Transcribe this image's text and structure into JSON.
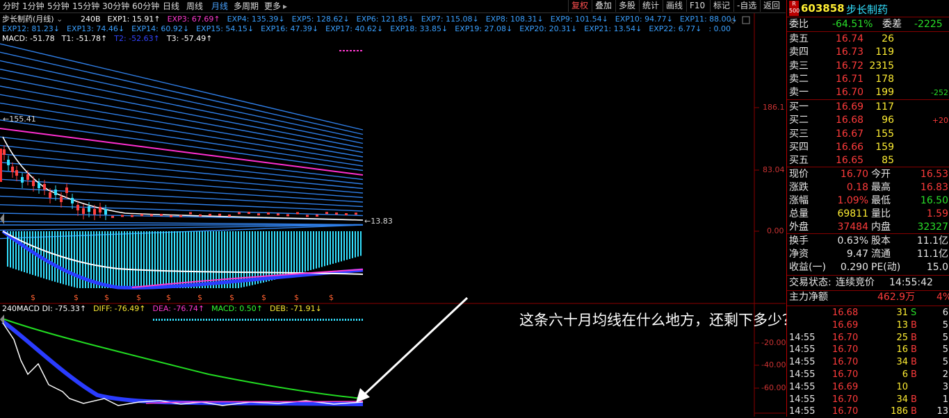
{
  "toolbar": {
    "tabs": [
      "分时",
      "1分钟",
      "5分钟",
      "15分钟",
      "30分钟",
      "60分钟",
      "日线",
      "周线",
      "月线",
      "多周期",
      "更多"
    ],
    "right_tabs": [
      "复权",
      "叠加",
      "多股",
      "统计",
      "画线",
      "F10",
      "标记",
      "-自选",
      "返回"
    ]
  },
  "chart": {
    "title": "步长制药(月线)",
    "exp_row1": [
      {
        "label": "240B",
        "color": "#ffffff"
      },
      {
        "label": "EXP1: 15.91↑",
        "color": "#ffffff"
      },
      {
        "label": "EXP3: 67.69↑",
        "color": "#ff3ad0"
      },
      {
        "label": "EXP4: 135.39↓",
        "color": "#3aa0ff"
      },
      {
        "label": "EXP5: 128.62↓",
        "color": "#3aa0ff"
      },
      {
        "label": "EXP6: 121.85↓",
        "color": "#3aa0ff"
      },
      {
        "label": "EXP7: 115.08↓",
        "color": "#3aa0ff"
      },
      {
        "label": "EXP8: 108.31↓",
        "color": "#3aa0ff"
      },
      {
        "label": "EXP9: 101.54↓",
        "color": "#3aa0ff"
      },
      {
        "label": "EXP10: 94.77↓",
        "color": "#3aa0ff"
      },
      {
        "label": "EXP11: 88.00↓",
        "color": "#3aa0ff"
      }
    ],
    "exp_row2": [
      {
        "label": "EXP12: 81.23↓",
        "color": "#3aa0ff"
      },
      {
        "label": "EXP13: 74.46↓",
        "color": "#3aa0ff"
      },
      {
        "label": "EXP14: 60.92↓",
        "color": "#3aa0ff"
      },
      {
        "label": "EXP15: 54.15↓",
        "color": "#3aa0ff"
      },
      {
        "label": "EXP16: 47.39↓",
        "color": "#3aa0ff"
      },
      {
        "label": "EXP17: 40.62↓",
        "color": "#3aa0ff"
      },
      {
        "label": "EXP18: 33.85↓",
        "color": "#3aa0ff"
      },
      {
        "label": "EXP19: 27.08↓",
        "color": "#3aa0ff"
      },
      {
        "label": "EXP20: 20.31↓",
        "color": "#3aa0ff"
      },
      {
        "label": "EXP21: 13.54↓",
        "color": "#3aa0ff"
      },
      {
        "label": "EXP22: 6.77↓",
        "color": "#3aa0ff"
      },
      {
        "label": ": 0.00",
        "color": "#3aa0ff"
      }
    ],
    "macd_row": [
      {
        "label": "MACD: -51.78",
        "color": "#ffffff"
      },
      {
        "label": "T1: -51.78↑",
        "color": "#ffffff"
      },
      {
        "label": "T2: -52.63↑",
        "color": "#3344ff"
      },
      {
        "label": "T3: -57.49↑",
        "color": "#ffffff"
      }
    ],
    "price_high": "155.41",
    "price_low": "13.83",
    "y_axis_main": [
      "186.1",
      "83.04",
      "0.00"
    ],
    "sub_title": [
      {
        "label": "240MACD DI: -75.33↑",
        "color": "#ffffff"
      },
      {
        "label": "DIFF: -76.49↑",
        "color": "#ffee33"
      },
      {
        "label": "DEA: -76.74↑",
        "color": "#ff3ad0"
      },
      {
        "label": "MACD: 0.50↑",
        "color": "#33ff33"
      },
      {
        "label": "DEB: -71.91↓",
        "color": "#ffee33"
      }
    ],
    "y_axis_sub": [
      "-20.00",
      "-40.00",
      "-60.00"
    ],
    "annotation": "这条六十月均线在什么地方，还剩下多少？"
  },
  "panel": {
    "code": "603858",
    "name": "步长制药",
    "badge_top": "R",
    "badge_bottom": "500",
    "weibi_label": "委比",
    "weibi_value": "-64.51%",
    "weicha_label": "委差",
    "weicha_value": "-2225",
    "sell": [
      {
        "label": "卖五",
        "price": "16.74",
        "vol": "26",
        "chg": ""
      },
      {
        "label": "卖四",
        "price": "16.73",
        "vol": "119",
        "chg": ""
      },
      {
        "label": "卖三",
        "price": "16.72",
        "vol": "2315",
        "chg": ""
      },
      {
        "label": "卖二",
        "price": "16.71",
        "vol": "178",
        "chg": ""
      },
      {
        "label": "卖一",
        "price": "16.70",
        "vol": "199",
        "chg": "-252"
      }
    ],
    "buy": [
      {
        "label": "买一",
        "price": "16.69",
        "vol": "117",
        "chg": ""
      },
      {
        "label": "买二",
        "price": "16.68",
        "vol": "96",
        "chg": "+20"
      },
      {
        "label": "买三",
        "price": "16.67",
        "vol": "155",
        "chg": ""
      },
      {
        "label": "买四",
        "price": "16.66",
        "vol": "159",
        "chg": ""
      },
      {
        "label": "买五",
        "price": "16.65",
        "vol": "85",
        "chg": ""
      }
    ],
    "stats": [
      {
        "l1": "现价",
        "v1": "16.70",
        "c1": "red",
        "l2": "今开",
        "v2": "16.53",
        "c2": "red"
      },
      {
        "l1": "涨跌",
        "v1": "0.18",
        "c1": "red",
        "l2": "最高",
        "v2": "16.83",
        "c2": "red"
      },
      {
        "l1": "涨幅",
        "v1": "1.09%",
        "c1": "red",
        "l2": "最低",
        "v2": "16.50",
        "c2": "green"
      },
      {
        "l1": "总量",
        "v1": "69811",
        "c1": "yellow",
        "l2": "量比",
        "v2": "1.59",
        "c2": "red"
      },
      {
        "l1": "外盘",
        "v1": "37484",
        "c1": "red",
        "l2": "内盘",
        "v2": "32327",
        "c2": "green"
      }
    ],
    "stats2": [
      {
        "l1": "换手",
        "v1": "0.63%",
        "l2": "股本",
        "v2": "11.1亿"
      },
      {
        "l1": "净资",
        "v1": "9.47",
        "l2": "流通",
        "v2": "11.1亿"
      },
      {
        "l1": "收益(一)",
        "v1": "0.290",
        "l2": "PE(动)",
        "v2": "15.0"
      }
    ],
    "trade_status_label": "交易状态:",
    "trade_status": "连续竞价",
    "trade_time": "14:55:42",
    "net_label": "主力净额",
    "net_value": "462.9万",
    "net_pct": "4%",
    "ticks": [
      {
        "time": "",
        "price": "16.68",
        "vol": "31",
        "bs": "S",
        "n": "6"
      },
      {
        "time": "",
        "price": "16.69",
        "vol": "13",
        "bs": "B",
        "n": "5"
      },
      {
        "time": "14:55",
        "price": "16.70",
        "vol": "25",
        "bs": "B",
        "n": "5"
      },
      {
        "time": "14:55",
        "price": "16.70",
        "vol": "16",
        "bs": "B",
        "n": "5"
      },
      {
        "time": "14:55",
        "price": "16.70",
        "vol": "34",
        "bs": "B",
        "n": "5"
      },
      {
        "time": "14:55",
        "price": "16.70",
        "vol": "6",
        "bs": "B",
        "n": "2"
      },
      {
        "time": "14:55",
        "price": "16.69",
        "vol": "10",
        "bs": "",
        "n": "3"
      },
      {
        "time": "14:55",
        "price": "16.70",
        "vol": "34",
        "bs": "B",
        "n": "1"
      },
      {
        "time": "14:55",
        "price": "16.70",
        "vol": "186",
        "bs": "B",
        "n": "13"
      }
    ]
  }
}
